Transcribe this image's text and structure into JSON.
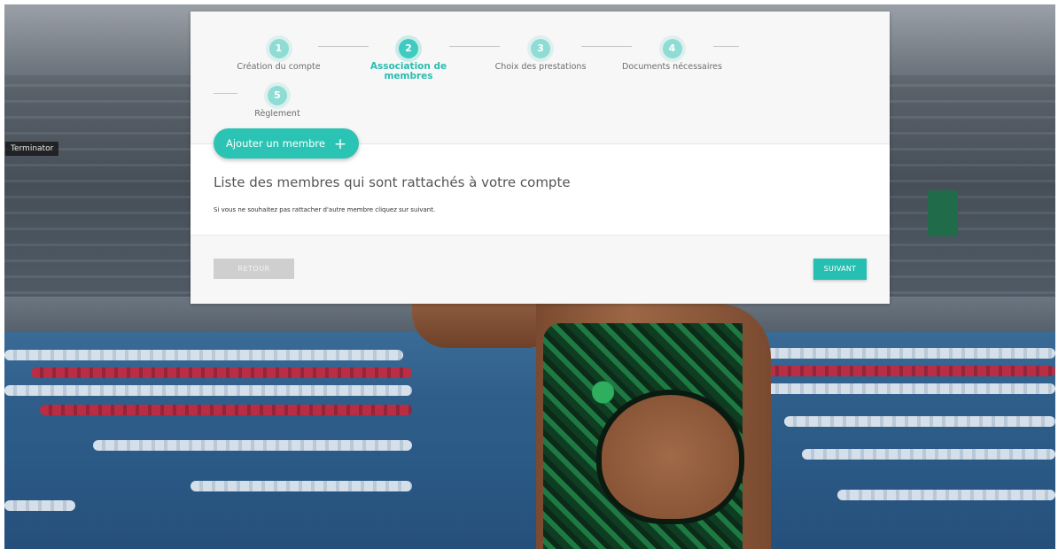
{
  "tooltip": {
    "text": "Terminator"
  },
  "stepper": {
    "steps": [
      {
        "number": "1",
        "label": "Création du compte",
        "active": false
      },
      {
        "number": "2",
        "label": "Association de membres",
        "active": true
      },
      {
        "number": "3",
        "label": "Choix des prestations",
        "active": false
      },
      {
        "number": "4",
        "label": "Documents nécessaires",
        "active": false
      },
      {
        "number": "5",
        "label": "Règlement",
        "active": false
      }
    ]
  },
  "members": {
    "add_button_label": "Ajouter un membre",
    "add_button_icon": "plus-icon",
    "title": "Liste des membres qui sont rattachés à votre compte",
    "hint": "Si vous ne souhaitez pas rattacher d'autre membre cliquez sur suivant."
  },
  "footer": {
    "back_label": "RETOUR",
    "next_label": "SUIVANT"
  },
  "colors": {
    "accent": "#2bc4b4",
    "step_circle": "#3ecbc0",
    "back_button": "#cfcfcf"
  }
}
